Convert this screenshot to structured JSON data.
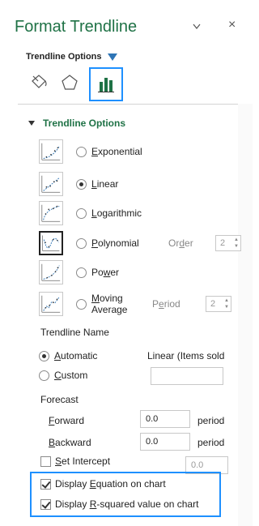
{
  "header": {
    "title": "Format Trendline",
    "close_glyph": "×",
    "subtitle": "Trendline Options"
  },
  "tabs": [
    {
      "icon": "paint-bucket-icon",
      "active": false
    },
    {
      "icon": "pentagon-icon",
      "active": false
    },
    {
      "icon": "bar-chart-icon",
      "active": true
    }
  ],
  "section": {
    "title": "Trendline Options"
  },
  "trend_types": [
    {
      "key": "exponential",
      "pre": "",
      "mnemonic": "E",
      "post": "xponential",
      "selected": false
    },
    {
      "key": "linear",
      "pre": "",
      "mnemonic": "L",
      "post": "inear",
      "selected": true
    },
    {
      "key": "logarithmic",
      "pre": "",
      "mnemonic": "L",
      "post": "ogarithmic",
      "selected": false
    },
    {
      "key": "polynomial",
      "pre": "",
      "mnemonic": "P",
      "post": "olynomial",
      "selected": false
    },
    {
      "key": "power",
      "pre": "Po",
      "mnemonic": "w",
      "post": "er",
      "selected": false
    },
    {
      "key": "moving-average",
      "pre": "",
      "mnemonic": "M",
      "post": "oving",
      "line2": "Average",
      "selected": false
    }
  ],
  "polynomial": {
    "order_pre": "Or",
    "order_mnemonic": "d",
    "order_post": "er",
    "order_value": "2"
  },
  "moving_average": {
    "period_pre": "P",
    "period_mnemonic": "e",
    "period_post": "riod",
    "period_value": "2"
  },
  "trendline_name": {
    "label": "Trendline Name",
    "automatic_mnemonic": "A",
    "automatic_post": "utomatic",
    "automatic_value": "Linear (Items sold",
    "custom_mnemonic": "C",
    "custom_post": "ustom",
    "custom_value": ""
  },
  "forecast": {
    "label": "Forecast",
    "forward_mnemonic": "F",
    "forward_post": "orward",
    "forward_value": "0.0",
    "backward_mnemonic": "B",
    "backward_post": "ackward",
    "backward_value": "0.0",
    "unit": "period"
  },
  "intercept": {
    "mnemonic": "S",
    "post": "et Intercept",
    "value": "0.0",
    "checked": false
  },
  "display_equation": {
    "pre": "Display ",
    "mnemonic": "E",
    "post": "quation on chart",
    "checked": true
  },
  "display_rsquared": {
    "pre": "Display ",
    "mnemonic": "R",
    "post": "-squared value on chart",
    "checked": true
  },
  "colors": {
    "accent_green": "#1f7246",
    "highlight_blue": "#1e90ff",
    "dropdown_blue": "#2e75b6"
  }
}
